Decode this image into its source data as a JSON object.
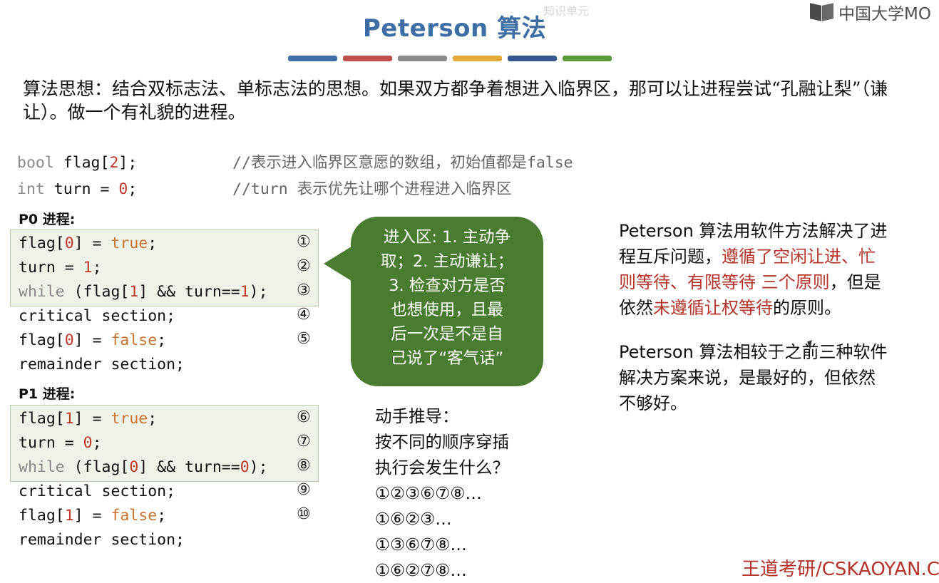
{
  "header": {
    "title": "Peterson 算法",
    "top_watermark": "知识单元",
    "logo_text": "中国大学MO",
    "color_bars": [
      "#3f6fa6",
      "#c0504d",
      "#8a8a8a",
      "#e2a93b",
      "#35588f",
      "#5a9a3c"
    ]
  },
  "intro": "算法思想：结合双标志法、单标志法的思想。如果双方都争着想进入临界区，那可以让进程尝试“孔融让梨”（谦让）。做一个有礼貌的进程。",
  "globals": {
    "line1": {
      "type": "bool",
      "code": " flag[",
      "idx": "2",
      "end": "];",
      "comment": "//表示进入临界区意愿的数组，初始值都是false"
    },
    "line2": {
      "type": "int",
      "code": " turn = ",
      "val": "0",
      "end": ";",
      "comment": "//turn 表示优先让哪个进程进入临界区"
    }
  },
  "p0": {
    "label": "P0 进程:",
    "l1": {
      "a": "flag[",
      "i": "0",
      "b": "] = ",
      "v": "true",
      "c": ";",
      "n": "①"
    },
    "l2": {
      "a": "turn = ",
      "v": "1",
      "c": ";",
      "n": "②"
    },
    "l3": {
      "kw": "while",
      "a": " (flag[",
      "i": "1",
      "b": "] && turn==",
      "v": "1",
      "c": ");",
      "n": "③"
    },
    "l4": {
      "a": "critical section;",
      "n": "④"
    },
    "l5": {
      "a": "flag[",
      "i": "0",
      "b": "] = ",
      "v": "false",
      "c": ";",
      "n": "⑤"
    },
    "l6": {
      "a": "remainder section;"
    }
  },
  "p1": {
    "label": "P1 进程:",
    "l1": {
      "a": "flag[",
      "i": "1",
      "b": "] = ",
      "v": "true",
      "c": ";",
      "n": "⑥"
    },
    "l2": {
      "a": "turn = ",
      "v": "0",
      "c": ";",
      "n": "⑦"
    },
    "l3": {
      "kw": "while",
      "a": " (flag[",
      "i": "0",
      "b": "] && turn==",
      "v": "0",
      "c": ");",
      "n": "⑧"
    },
    "l4": {
      "a": "critical section;",
      "n": "⑨"
    },
    "l5": {
      "a": "flag[",
      "i": "1",
      "b": "] = ",
      "v": "false",
      "c": ";",
      "n": "⑩"
    },
    "l6": {
      "a": "remainder section;"
    }
  },
  "bubble": [
    "进入区: 1. 主动争",
    "取；2. 主动谦让；",
    "3. 检查对方是否",
    "也想使用，且最",
    "后一次是不是自",
    "己说了“客气话”"
  ],
  "derive": [
    "动手推导：",
    "按不同的顺序穿插",
    "执行会发生什么？",
    "①②③⑥⑦⑧…",
    "①⑥②③…",
    "①③⑥⑦⑧…",
    "①⑥②⑦⑧…"
  ],
  "note1": {
    "l1": "Peterson 算法用软件方法解决了进",
    "l2a": "程互斥问题，",
    "l2b": "遵循了空闲让进、忙",
    "l3a": "则等待、有限等待 三个原则",
    "l3b": "，但是",
    "l4a": "依然",
    "l4b": "未遵循让权等待",
    "l4c": "的原则。"
  },
  "note2": [
    "Peterson 算法相较于之前三种软件",
    "解决方案来说，是最好的，但依然",
    "不够好。"
  ],
  "bottom_watermark": "王道考研/CSKAOYAN.C"
}
